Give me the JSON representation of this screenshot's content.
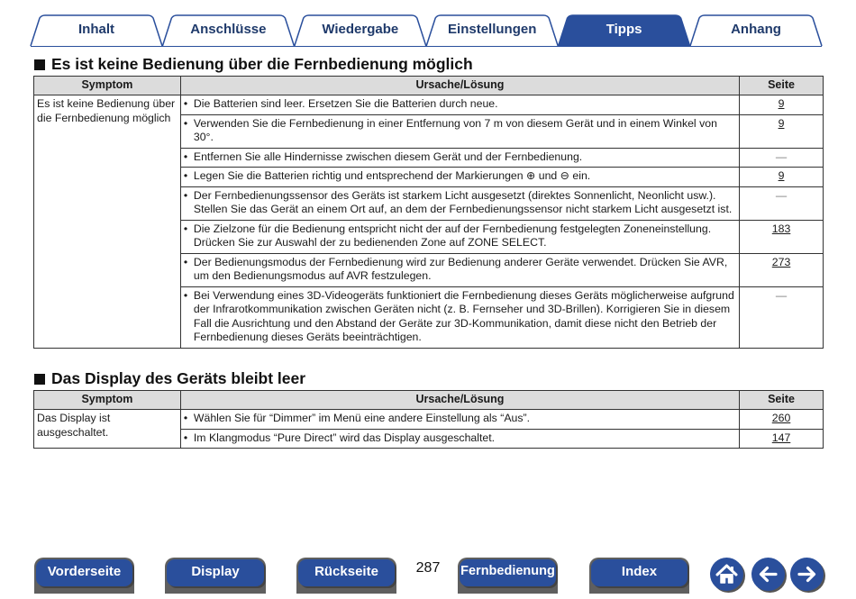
{
  "tabs": [
    {
      "label": "Inhalt",
      "active": false
    },
    {
      "label": "Anschlüsse",
      "active": false
    },
    {
      "label": "Wiedergabe",
      "active": false
    },
    {
      "label": "Einstellungen",
      "active": false
    },
    {
      "label": "Tipps",
      "active": true
    },
    {
      "label": "Anhang",
      "active": false
    }
  ],
  "colors": {
    "tab_blue": "#2a4f9c",
    "tab_text": "#1f3a6b",
    "header_gray": "#dcdcdc"
  },
  "sections": [
    {
      "title": "Es ist keine Bedienung über die Fernbedienung möglich",
      "headers": {
        "symptom": "Symptom",
        "cause": "Ursache/Lösung",
        "page": "Seite"
      },
      "symptom": "Es ist keine Bedienung über die Fernbedienung möglich",
      "rows": [
        {
          "text": "Die Batterien sind leer. Ersetzen Sie die Batterien durch neue.",
          "page": "9"
        },
        {
          "text": "Verwenden Sie die Fernbedienung in einer Entfernung von 7 m von diesem Gerät und in einem Winkel von 30°.",
          "page": "9"
        },
        {
          "text": "Entfernen Sie alle Hindernisse zwischen diesem Gerät und der Fernbedienung.",
          "page": "—"
        },
        {
          "text": "Legen Sie die Batterien richtig und entsprechend der Markierungen ⊕ und ⊖ ein.",
          "page": "9"
        },
        {
          "text": "Der Fernbedienungssensor des Geräts ist starkem Licht ausgesetzt (direktes Sonnenlicht, Neonlicht usw.). Stellen Sie das Gerät an einem Ort auf, an dem der Fernbedienungssensor nicht starkem Licht ausgesetzt ist.",
          "page": "—"
        },
        {
          "text": "Die Zielzone für die Bedienung entspricht nicht der auf der Fernbedienung festgelegten Zoneneinstellung. Drücken Sie zur Auswahl der zu bedienenden Zone auf ZONE SELECT.",
          "page": "183"
        },
        {
          "text": "Der Bedienungsmodus der Fernbedienung wird zur Bedienung anderer Geräte verwendet. Drücken Sie AVR, um den Bedienungsmodus auf AVR festzulegen.",
          "page": "273"
        },
        {
          "text": "Bei Verwendung eines 3D-Videogeräts funktioniert die Fernbedienung dieses Geräts möglicherweise aufgrund der Infrarotkommunikation zwischen Geräten nicht (z. B. Fernseher und 3D-Brillen). Korrigieren Sie in diesem Fall die Ausrichtung und den Abstand der Geräte zur 3D-Kommunikation, damit diese nicht den Betrieb der Fernbedienung dieses Geräts beeinträchtigen.",
          "page": "—"
        }
      ]
    },
    {
      "title": "Das Display des Geräts bleibt leer",
      "headers": {
        "symptom": "Symptom",
        "cause": "Ursache/Lösung",
        "page": "Seite"
      },
      "symptom": "Das Display ist ausgeschaltet.",
      "rows": [
        {
          "text": "Wählen Sie für “Dimmer” im Menü eine andere Einstellung als “Aus”.",
          "page": "260"
        },
        {
          "text": "Im Klangmodus “Pure Direct” wird das Display ausgeschaltet.",
          "page": "147"
        }
      ]
    }
  ],
  "footer": {
    "buttons": [
      "Vorderseite",
      "Display",
      "Rückseite",
      "Fernbedienung",
      "Index"
    ],
    "page_number": "287",
    "icons": [
      "home-icon",
      "arrow-left-icon",
      "arrow-right-icon"
    ]
  }
}
